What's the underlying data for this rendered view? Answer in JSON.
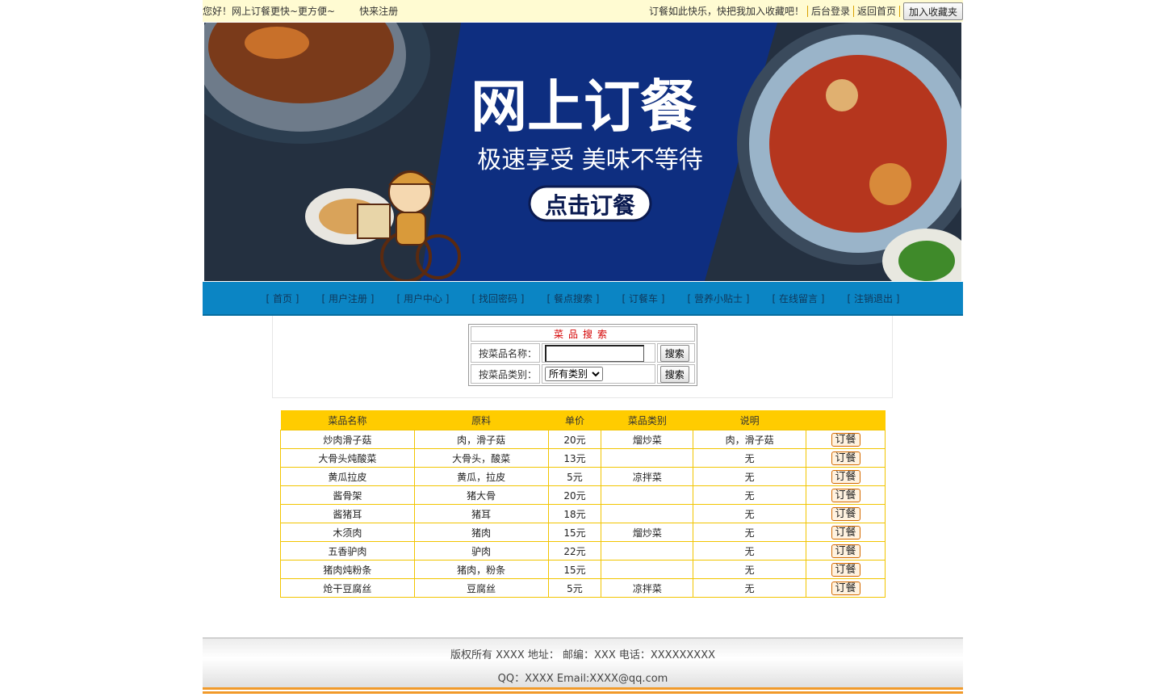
{
  "topbar": {
    "greeting": "您好！网上订餐更快~更方便~",
    "register_link": "快来注册",
    "slogan": "订餐如此快乐，快把我加入收藏吧！",
    "admin_login": "后台登录",
    "back_home": "返回首页",
    "add_favorite": "加入收藏夹"
  },
  "banner": {
    "title": "网上订餐",
    "subtitle": "极速享受 美味不等待",
    "cta": "点击订餐",
    "colors": {
      "panel": "#0e2e80",
      "bg": "#243040"
    }
  },
  "nav": {
    "items": [
      "[ 首页 ]",
      "[ 用户注册 ]",
      "[ 用户中心 ]",
      "[ 找回密码 ]",
      "[ 餐点搜索 ]",
      "[ 订餐车 ]",
      "[ 营养小贴士 ]",
      "[ 在线留言 ]",
      "[ 注销退出 ]"
    ]
  },
  "search": {
    "title": "菜品搜索",
    "by_name_label": "按菜品名称：",
    "by_name_value": "",
    "by_category_label": "按菜品类别：",
    "category_selected": "所有类别",
    "search_button": "搜索"
  },
  "dishes": {
    "headers": [
      "菜品名称",
      "原料",
      "单价",
      "菜品类别",
      "说明",
      ""
    ],
    "order_label": "订餐",
    "rows": [
      [
        "炒肉滑子菇",
        "肉，滑子菇",
        "20元",
        "熘炒菜",
        "肉，滑子菇"
      ],
      [
        "大骨头炖酸菜",
        "大骨头，酸菜",
        "13元",
        "",
        "无"
      ],
      [
        "黄瓜拉皮",
        "黄瓜，拉皮",
        "5元",
        "凉拌菜",
        "无"
      ],
      [
        "酱骨架",
        "猪大骨",
        "20元",
        "",
        "无"
      ],
      [
        "酱猪耳",
        "猪耳",
        "18元",
        "",
        "无"
      ],
      [
        "木须肉",
        "猪肉",
        "15元",
        "熘炒菜",
        "无"
      ],
      [
        "五香驴肉",
        "驴肉",
        "22元",
        "",
        "无"
      ],
      [
        "猪肉炖粉条",
        "猪肉，粉条",
        "15元",
        "",
        "无"
      ],
      [
        "炝干豆腐丝",
        "豆腐丝",
        "5元",
        "凉拌菜",
        "无"
      ]
    ]
  },
  "footer": {
    "line1": "版权所有 XXXX 地址：  邮编：XXX 电话：XXXXXXXXX",
    "line2": "QQ：XXXX  Email:XXXX@qq.com"
  }
}
